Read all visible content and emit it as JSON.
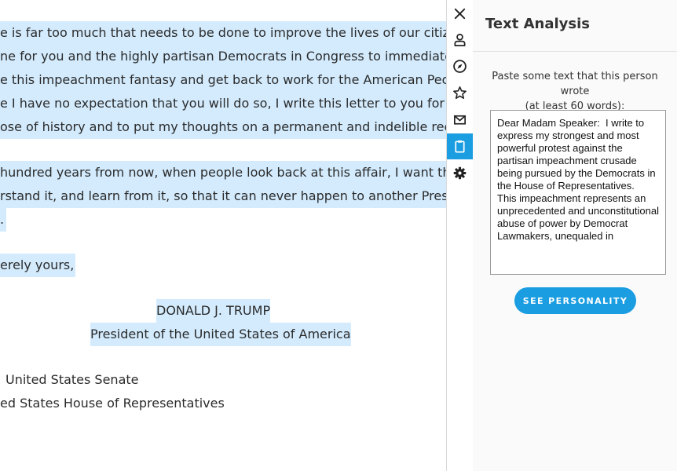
{
  "letter": {
    "lines": [
      "e is far too much that needs to be done to improve the lives of our citizens.  It",
      "ne for you and the highly partisan Democrats in Congress to immediately",
      "e this impeachment fantasy and get back to work for the American People.",
      "e I have no expectation that you will do so, I write this letter to you for the",
      "ose of history and to put my thoughts on a permanent and indelible record.",
      "hundred years from now, when people look back at this affair, I want them to",
      "rstand it, and learn from it, so that it can never happen to another President",
      ".",
      "erely yours,",
      "DONALD J. TRUMP",
      "President of the United States of America",
      "United States Senate",
      "ed States House of Representatives"
    ]
  },
  "rail": {
    "icons": [
      "close-icon",
      "person-icon",
      "compass-icon",
      "star-icon",
      "mail-icon",
      "clipboard-icon",
      "gear-icon"
    ],
    "active": "clipboard-icon"
  },
  "panel": {
    "title": "Text Analysis",
    "prompt_line1": "Paste some text that this person wrote",
    "prompt_line2": "(at least 60 words):",
    "textarea_value": "Dear Madam Speaker:  I write to express my strongest and most powerful protest against the partisan impeachment crusade being pursued by the Democrats in the House of Representatives.  This impeachment represents an unprecedented and unconstitutional abuse of power by Democrat Lawmakers, unequaled in",
    "button_label": "SEE PERSONALITY"
  },
  "colors": {
    "accent": "#1a9de1",
    "highlight": "#d3ebfd"
  }
}
